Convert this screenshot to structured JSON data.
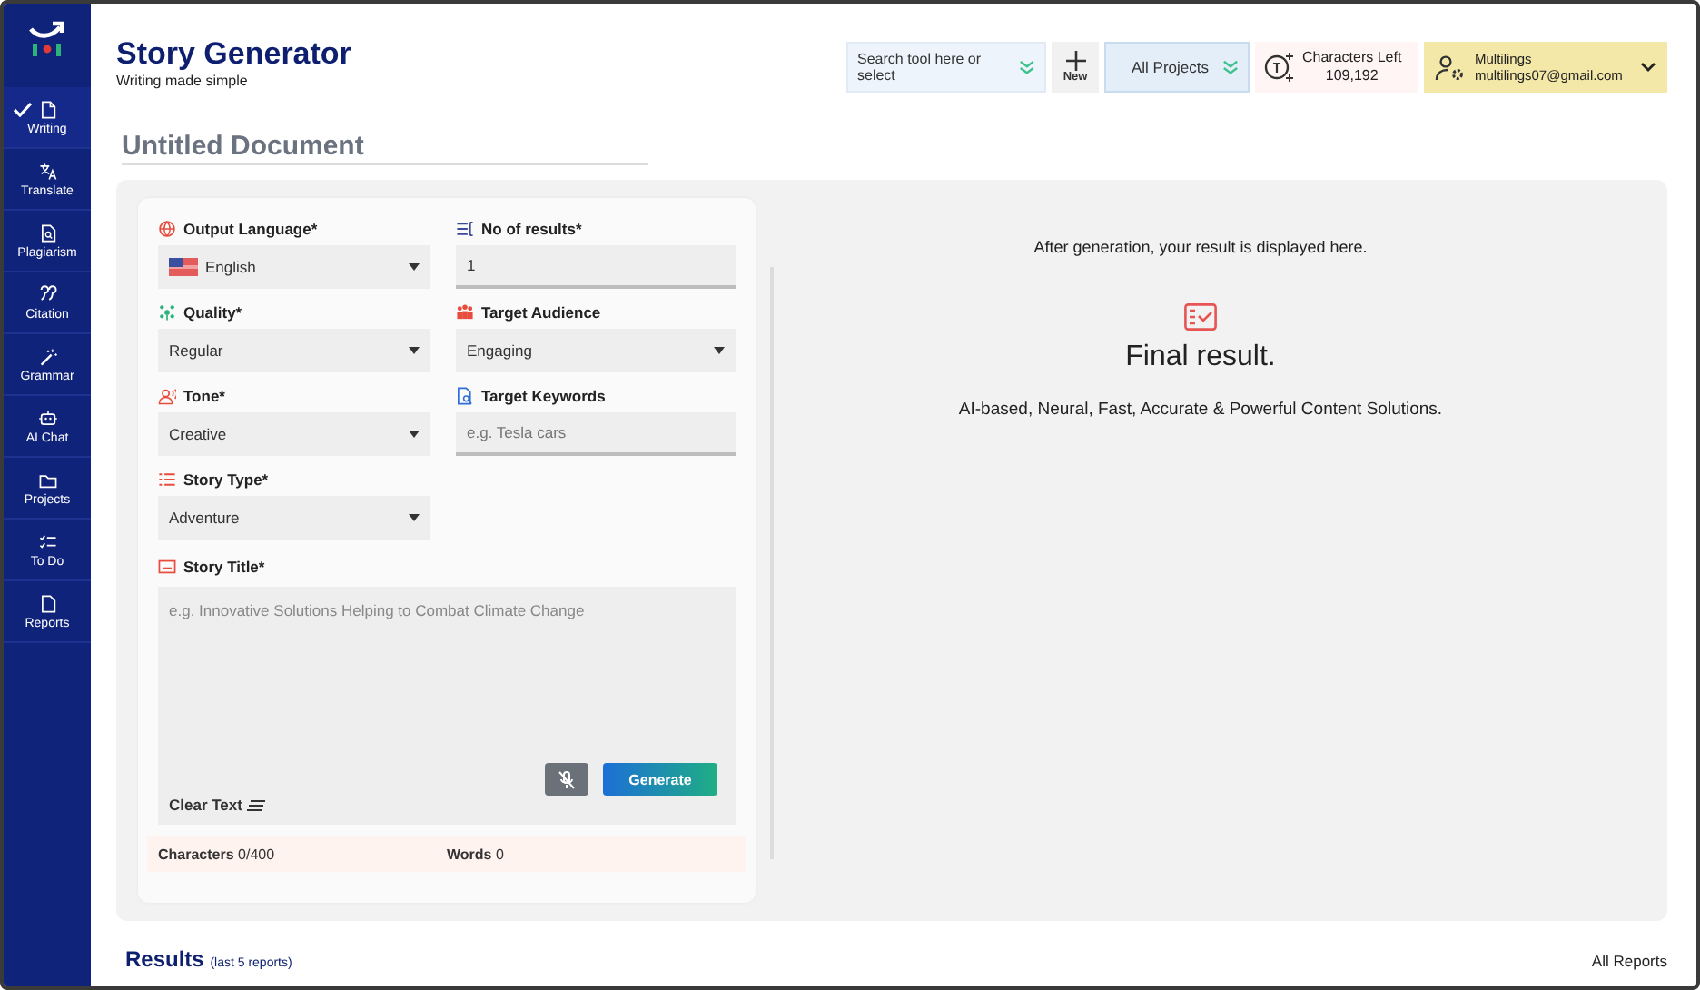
{
  "sidebar": {
    "items": [
      {
        "label": "Writing",
        "selected": true
      },
      {
        "label": "Translate",
        "selected": false
      },
      {
        "label": "Plagiarism",
        "selected": false
      },
      {
        "label": "Citation",
        "selected": false
      },
      {
        "label": "Grammar",
        "selected": false
      },
      {
        "label": "AI Chat",
        "selected": false
      },
      {
        "label": "Projects",
        "selected": false
      },
      {
        "label": "To Do",
        "selected": false
      },
      {
        "label": "Reports",
        "selected": false
      }
    ]
  },
  "header": {
    "title": "Story Generator",
    "subtitle": "Writing made simple",
    "tool_search": {
      "placeholder": "Search tool here or select"
    },
    "new_button": "New",
    "project_select": "All Projects",
    "characters_left": {
      "label": "Characters Left",
      "value": "109,192"
    },
    "user": {
      "name": "Multilings",
      "email": "multilings07@gmail.com"
    }
  },
  "document_title": "Untitled Document",
  "form": {
    "fields": [
      {
        "label": "Output Language*",
        "kind": "select",
        "value": "English"
      },
      {
        "label": "No of results*",
        "kind": "input",
        "value": "1"
      },
      {
        "label": "Quality*",
        "kind": "select",
        "value": "Regular"
      },
      {
        "label": "Target Audience",
        "kind": "select",
        "value": "Engaging"
      },
      {
        "label": "Tone*",
        "kind": "select",
        "value": "Creative"
      },
      {
        "label": "Target Keywords",
        "kind": "input",
        "placeholder": "e.g. Tesla cars"
      },
      {
        "label": "Story Type*",
        "kind": "select",
        "value": "Adventure"
      }
    ],
    "story_title": {
      "label": "Story Title*",
      "placeholder": "e.g. Innovative Solutions Helping to Combat Climate Change"
    },
    "clear_text": "Clear Text",
    "generate_button": "Generate",
    "counts": [
      "**Characters** 0/400",
      "**Words** 0"
    ]
  },
  "result": {
    "hint": "After generation, your result is displayed here.",
    "title": "Final result.",
    "tagline": "AI-based, Neural, Fast, Accurate & Powerful Content Solutions."
  },
  "results_section": {
    "title": "Results",
    "note": "(last 5 reports)",
    "link": "All Reports"
  }
}
